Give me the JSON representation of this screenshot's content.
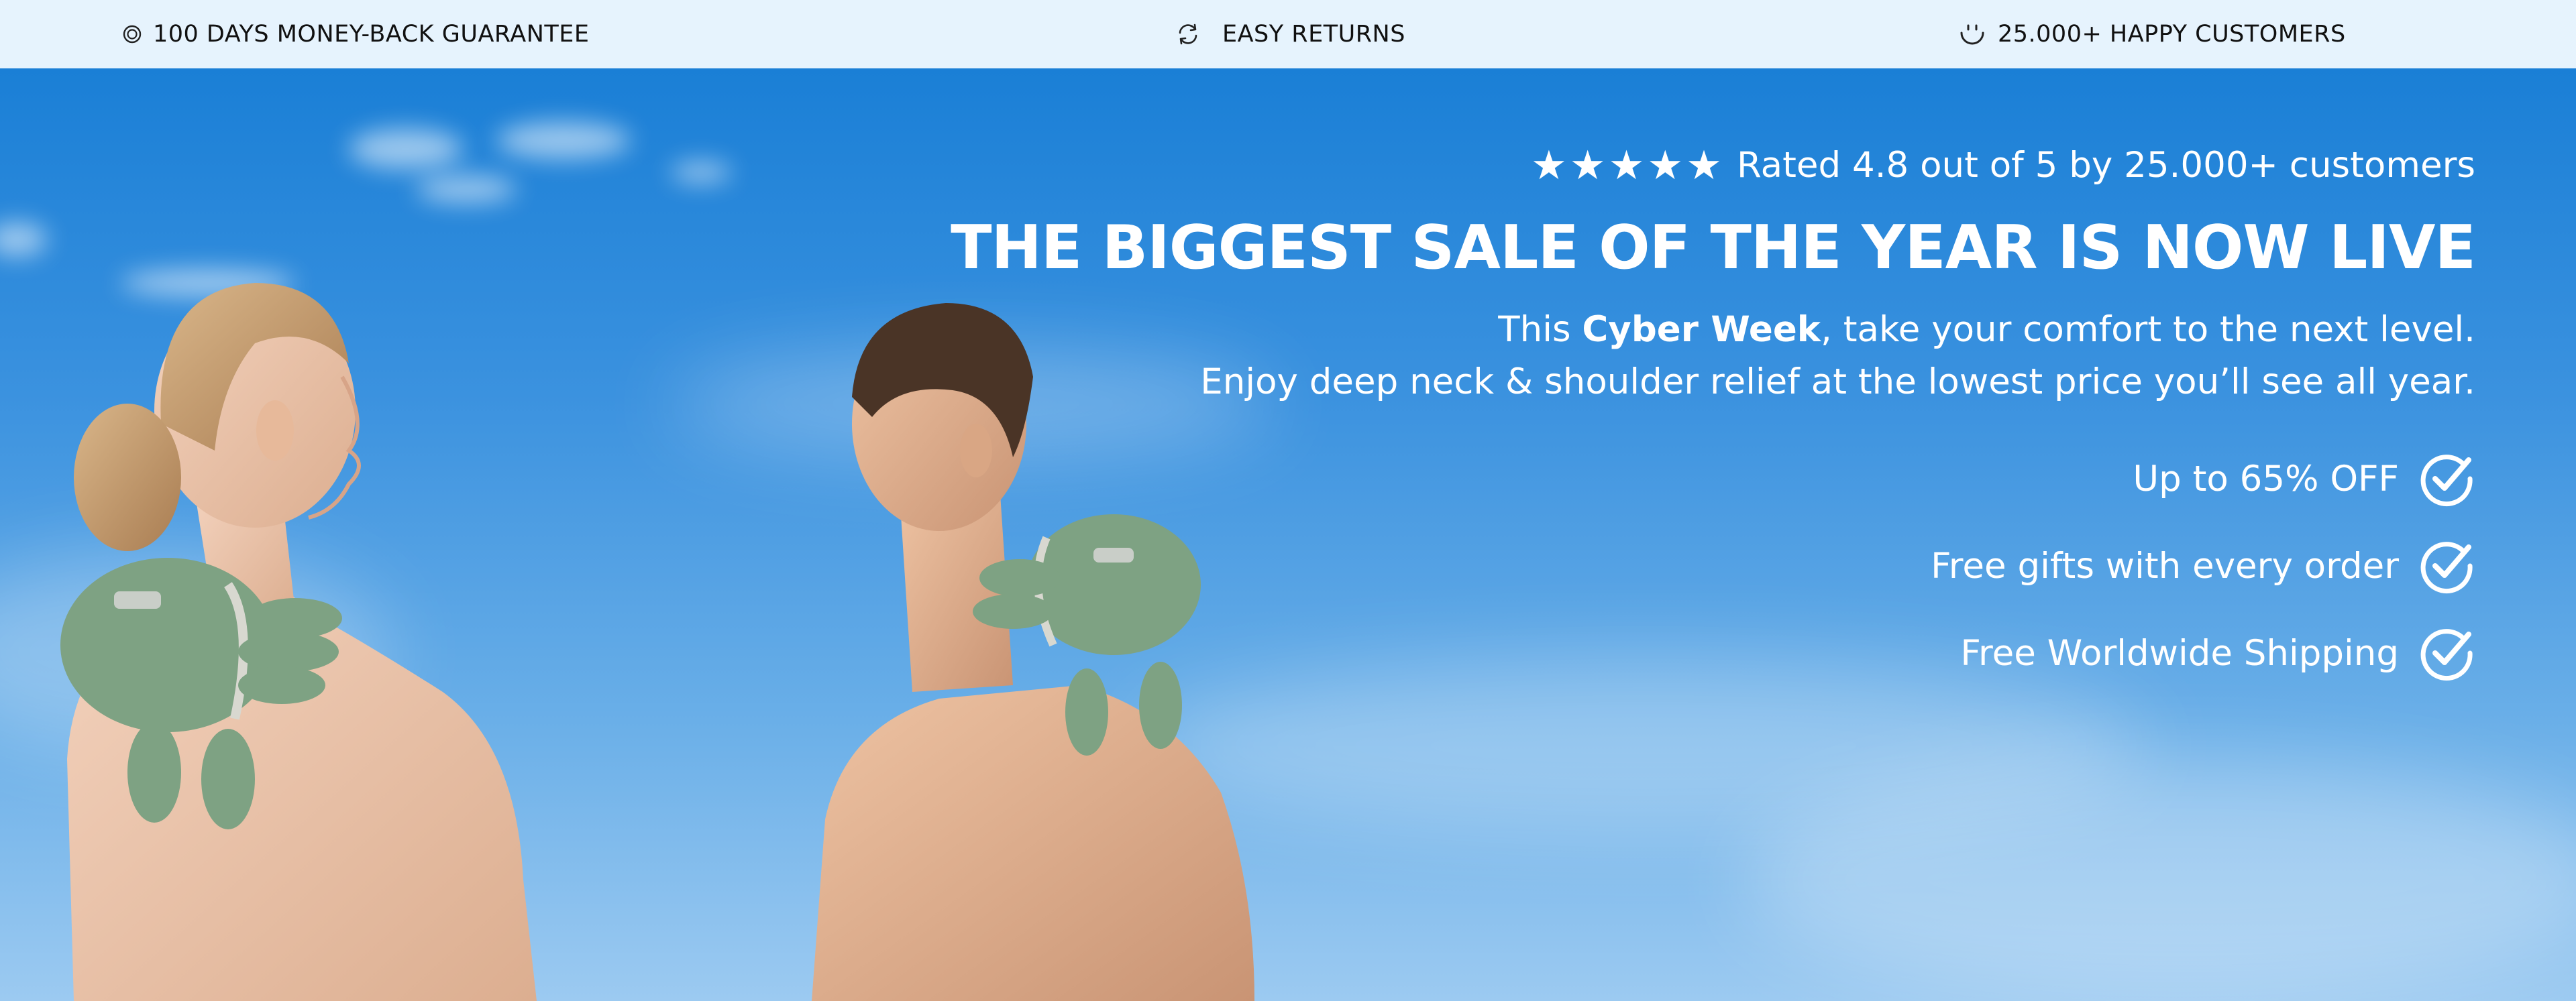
{
  "topbar": {
    "items": [
      {
        "icon": "medal-icon",
        "label": "100 DAYS MONEY-BACK GUARANTEE"
      },
      {
        "icon": "refresh-icon",
        "label": "EASY RETURNS"
      },
      {
        "icon": "smile-icon",
        "label": "25.000+ HAPPY CUSTOMERS"
      }
    ]
  },
  "hero": {
    "rating": {
      "stars": "★★★★★",
      "stars_value": 5,
      "text": "Rated 4.8 out of 5 by 25.000+ customers"
    },
    "headline": "THE BIGGEST SALE OF THE YEAR IS NOW LIVE",
    "subline1": {
      "pre": "This ",
      "bold": "Cyber Week",
      "post": ", take your comfort to the next level."
    },
    "subline2": "Enjoy deep neck & shoulder relief at the lowest price you’ll see all year.",
    "benefits": [
      {
        "label": "Up to 65% OFF",
        "icon": "check-circle-icon"
      },
      {
        "label": "Free gifts with every order",
        "icon": "check-circle-icon"
      },
      {
        "label": "Free Worldwide Shipping",
        "icon": "check-circle-icon"
      }
    ]
  },
  "colors": {
    "topbar_bg": "#e6f3fd",
    "sky_top": "#1a7fd6",
    "sky_bottom": "#9ccaf1",
    "device_green": "#7ea283",
    "text_on_hero": "#ffffff"
  }
}
